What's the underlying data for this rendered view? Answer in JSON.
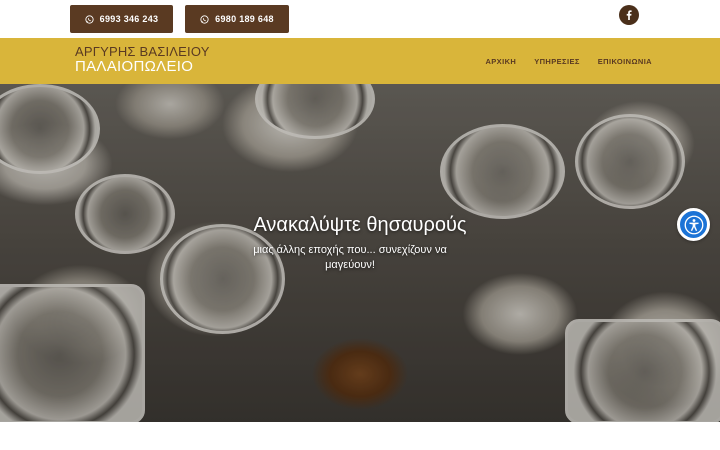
{
  "topbar": {
    "phones": [
      {
        "label": "6993 346 243",
        "icon": "whatsapp-icon"
      },
      {
        "label": "6980 189 648",
        "icon": "whatsapp-icon"
      }
    ],
    "social": {
      "icon": "facebook-icon"
    }
  },
  "header": {
    "brand_line1": "ΑΡΓΥΡΗΣ ΒΑΣΙΛΕΙΟΥ",
    "brand_line2": "ΠΑΛΑΙΟΠΩΛΕΙΟ",
    "nav": [
      {
        "label": "ΑΡΧΙΚΗ"
      },
      {
        "label": "ΥΠΗΡΕΣΙΕΣ"
      },
      {
        "label": "ΕΠΙΚΟΙΝΩΝΙΑ"
      }
    ]
  },
  "hero": {
    "title": "Ανακαλύψτε θησαυρούς",
    "subtitle": "μιας άλλης εποχής που... συνεχίζουν να μαγεύουν!"
  },
  "accessibility": {
    "icon": "accessibility-icon"
  },
  "colors": {
    "brown": "#5a3a22",
    "gold": "#d9b53a",
    "accessibility_blue": "#1b73d6"
  }
}
